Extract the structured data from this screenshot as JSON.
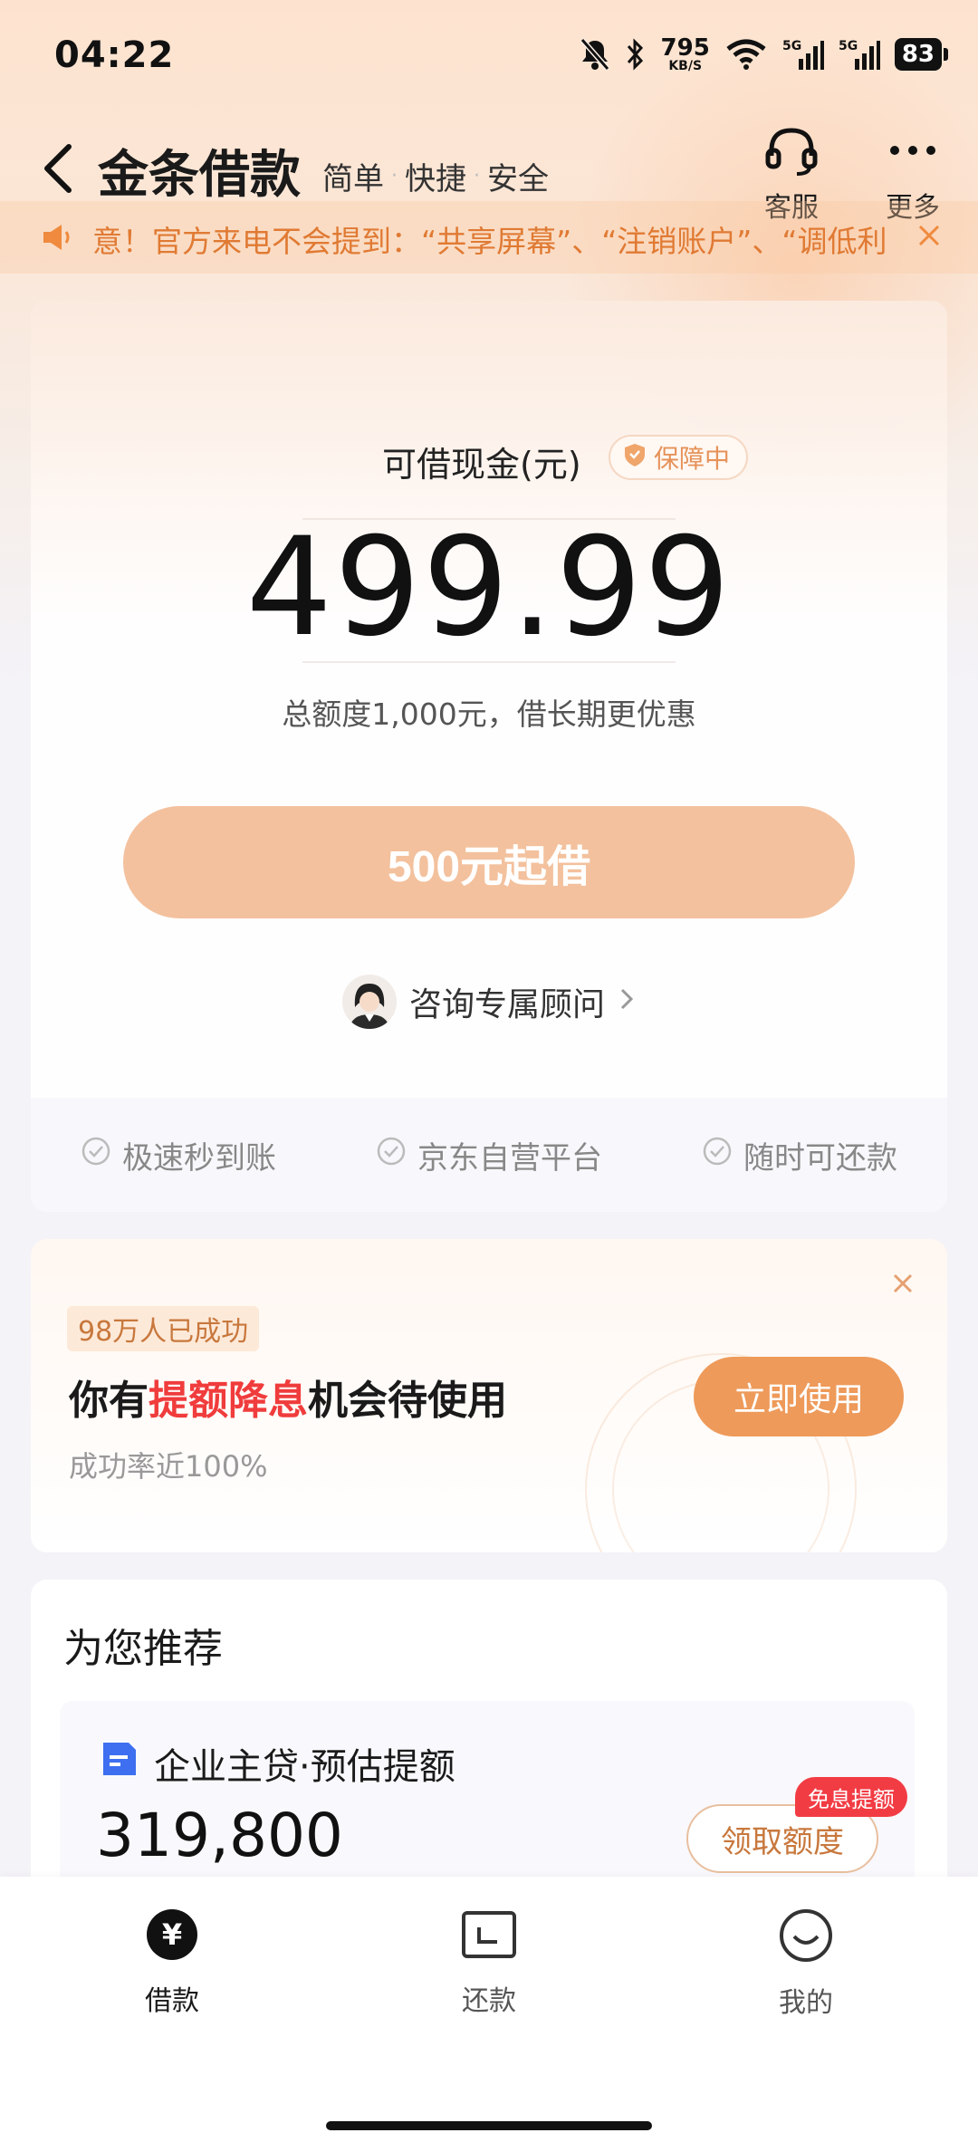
{
  "status_bar": {
    "time": "04:22",
    "net_speed": "795",
    "net_unit": "KB/S",
    "sig1": "5G",
    "sig2": "5G",
    "battery": "83"
  },
  "header": {
    "title": "金条借款",
    "subtitle": [
      "简单",
      "快捷",
      "安全"
    ],
    "service_label": "客服",
    "more_label": "更多"
  },
  "notice": {
    "text": "意！官方来电不会提到：“共享屏幕”、“注销账户”、“调低利"
  },
  "main_card": {
    "cash_label": "可借现金(元)",
    "guard_badge": "保障中",
    "amount": "499.99",
    "total_text": "总额度1,000元，借长期更优惠",
    "borrow_button": "500元起借",
    "advisor_label": "咨询专属顾问",
    "features": [
      "极速秒到账",
      "京东自营平台",
      "随时可还款"
    ]
  },
  "promo": {
    "tag": "98万人已成功",
    "headline_pre": "你有",
    "headline_hl": "提额降息",
    "headline_post": "机会待使用",
    "rate": "成功率近100%",
    "button": "立即使用"
  },
  "recommend": {
    "title": "为您推荐",
    "item_name": "企业主贷·预估提额",
    "item_value": "319,800",
    "item_button": "领取额度",
    "item_badge": "免息提额"
  },
  "nav": {
    "items": [
      {
        "label": "借款",
        "glyph": "¥"
      },
      {
        "label": "还款"
      },
      {
        "label": "我的"
      }
    ]
  },
  "colors": {
    "accent": "#ee9a5a",
    "button_disabled": "#f3c19d",
    "highlight_red": "#f03c3c",
    "notice_text": "#e07a33"
  }
}
